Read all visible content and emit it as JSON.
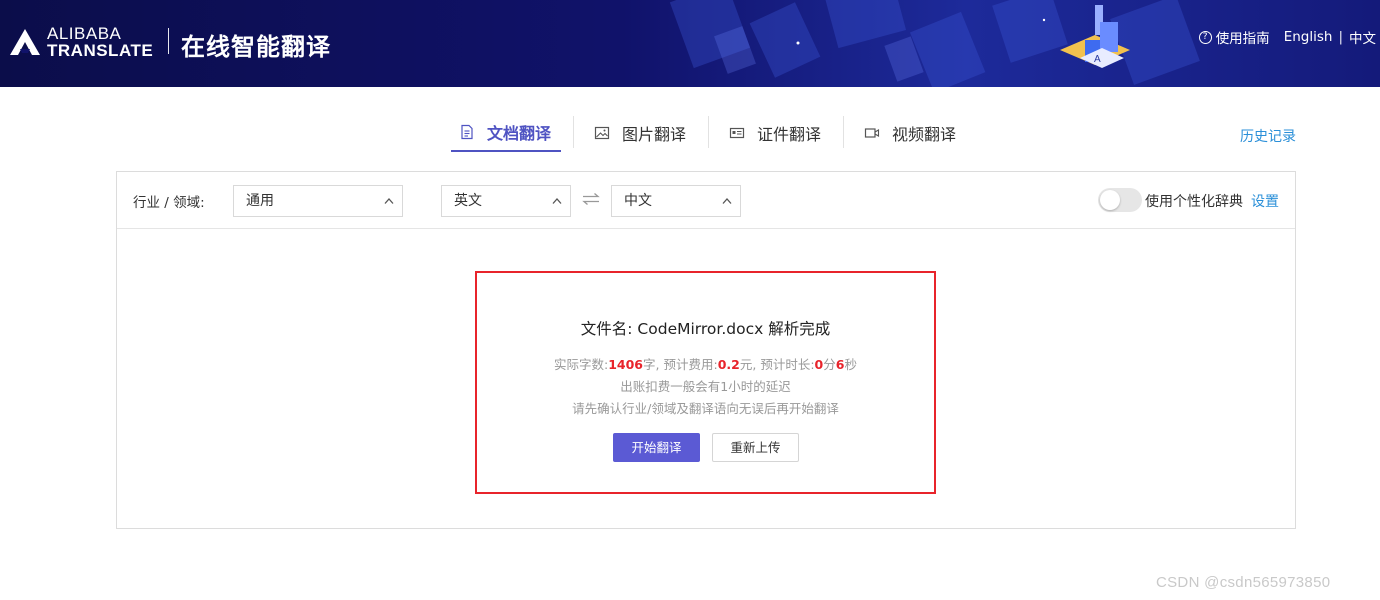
{
  "header": {
    "logo_line1": "ALIBABA",
    "logo_line2": "TRANSLATE",
    "title": "在线智能翻译",
    "guide_label": "使用指南",
    "lang_en": "English",
    "lang_sep": "|",
    "lang_zh": "中文",
    "logo_icon": "alibaba-a-icon",
    "guide_icon": "question-circle-icon"
  },
  "tabs": [
    {
      "label": "文档翻译",
      "icon": "document-icon",
      "active": true
    },
    {
      "label": "图片翻译",
      "icon": "image-icon",
      "active": false
    },
    {
      "label": "证件翻译",
      "icon": "id-card-icon",
      "active": false
    },
    {
      "label": "视频翻译",
      "icon": "video-icon",
      "active": false
    }
  ],
  "history_label": "历史记录",
  "toolbar": {
    "industry_label": "行业 / 领域:",
    "industry_value": "通用",
    "source_lang": "英文",
    "target_lang": "中文",
    "personal_dict_label": "使用个性化辞典",
    "personal_dict_enabled": false,
    "settings_label": "设置"
  },
  "result": {
    "file_prefix": "文件名: ",
    "file_name": "CodeMirror.docx",
    "file_suffix": " 解析完成",
    "chars_label": "实际字数:",
    "chars_value": "1406",
    "chars_unit": "字,",
    "cost_label": "预计费用:",
    "cost_value": "0.2",
    "cost_unit": "元,",
    "time_label": "预计时长:",
    "time_min": "0",
    "time_min_unit": "分",
    "time_sec": "6",
    "time_sec_unit": "秒",
    "note1": "出账扣费一般会有1小时的延迟",
    "note2": "请先确认行业/领域及翻译语向无误后再开始翻译",
    "start_button": "开始翻译",
    "reupload_button": "重新上传"
  },
  "watermark": "CSDN @csdn565973850",
  "colors": {
    "header_bg": "#10126a",
    "accent": "#4f53c2",
    "button": "#5b5ad4",
    "link": "#2a8fd8",
    "highlight_red": "#e8242b"
  }
}
